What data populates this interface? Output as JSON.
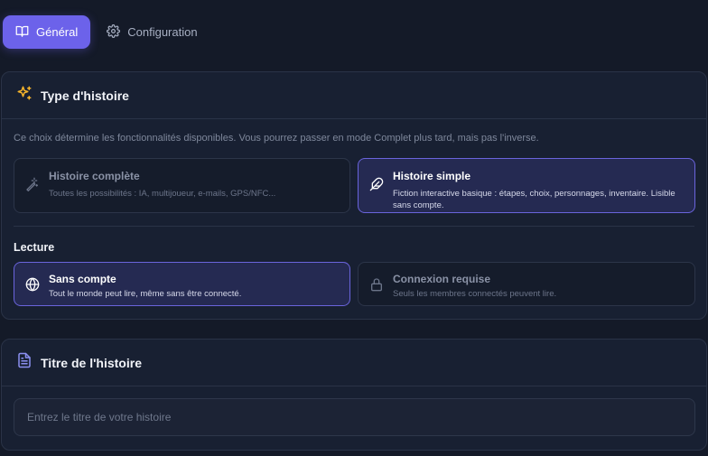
{
  "tabs": [
    {
      "label": "Général",
      "icon": "book-icon",
      "active": true
    },
    {
      "label": "Configuration",
      "icon": "gear-icon",
      "active": false
    }
  ],
  "story_type": {
    "title": "Type d'histoire",
    "icon": "sparkles-icon",
    "helper": "Ce choix détermine les fonctionnalités disponibles. Vous pourrez passer en mode Complet plus tard, mais pas l'inverse.",
    "options": [
      {
        "title": "Histoire complète",
        "description": "Toutes les possibilités : IA, multijoueur, e-mails, GPS/NFC...",
        "icon": "magic-wand-icon",
        "selected": false
      },
      {
        "title": "Histoire simple",
        "description": "Fiction interactive basique : étapes, choix, personnages, inventaire. Lisible sans compte.",
        "icon": "feather-icon",
        "selected": true
      }
    ]
  },
  "reading": {
    "label": "Lecture",
    "options": [
      {
        "title": "Sans compte",
        "description": "Tout le monde peut lire, même sans être connecté.",
        "icon": "globe-icon",
        "selected": true
      },
      {
        "title": "Connexion requise",
        "description": "Seuls les membres connectés peuvent lire.",
        "icon": "lock-icon",
        "selected": false
      }
    ]
  },
  "story_title": {
    "title": "Titre de l'histoire",
    "icon": "document-icon",
    "value": "",
    "placeholder": "Entrez le titre de votre histoire"
  },
  "colors": {
    "accent": "#6c62ea",
    "background": "#141a28",
    "card": "#182032",
    "selected_card": "#252a52",
    "sparkles_icon": "#f5b32b",
    "document_icon": "#8b8ff0"
  }
}
